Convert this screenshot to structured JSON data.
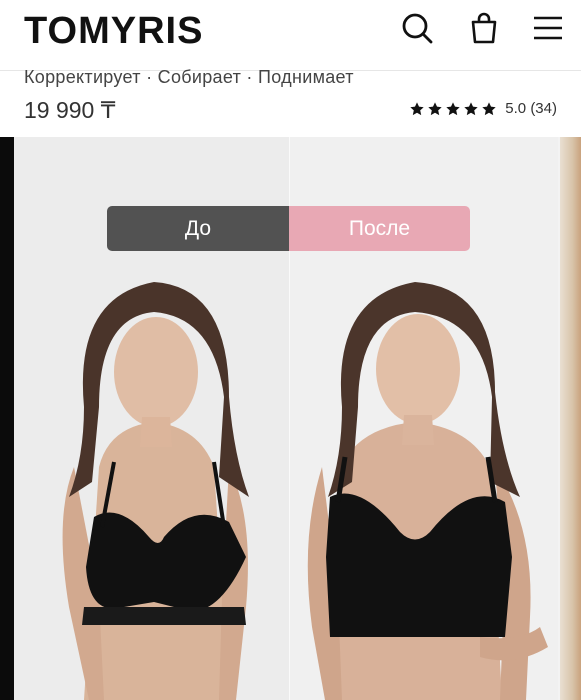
{
  "header": {
    "logo": "TOMYRIS",
    "icons": [
      "search-icon",
      "shopping-bag-icon",
      "menu-icon"
    ]
  },
  "product": {
    "features": "Корректирует · Собирает · Поднимает",
    "price": "19 990 ₸",
    "rating_value": 5.0,
    "rating_stars": 5,
    "rating_text": "5.0 (34)"
  },
  "gallery": {
    "toggle_before": "До",
    "toggle_after": "После"
  },
  "colors": {
    "before_button": "#525252",
    "after_button": "#e8a8b4",
    "text": "#111111"
  }
}
